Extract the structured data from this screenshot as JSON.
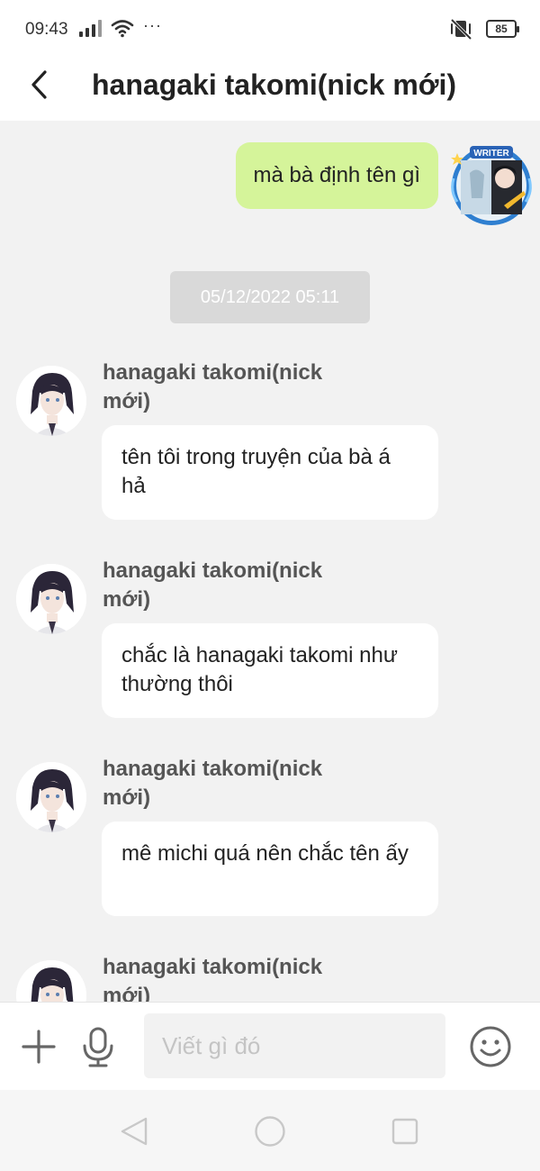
{
  "status_bar": {
    "time": "09:43",
    "battery": "85",
    "icons": [
      "signal-icon",
      "wifi-icon",
      "more-dots-icon",
      "vibrate-mute-icon",
      "battery-icon"
    ]
  },
  "header": {
    "title": "hanagaki takomi(nick mới)",
    "back_icon": "chevron-left-icon"
  },
  "messages": {
    "outgoing": {
      "text": "mà bà định tên gì",
      "avatar_badge": "WRITER"
    },
    "date_separator": "05/12/2022 05:11",
    "incoming": [
      {
        "sender": "hanagaki takomi(nick mới)",
        "text": "tên tôi trong truyện của bà á hả"
      },
      {
        "sender": "hanagaki takomi(nick mới)",
        "text": "chắc là hanagaki takomi như thường thôi"
      },
      {
        "sender": "hanagaki takomi(nick mới)",
        "text": "mê michi quá nên chắc tên ấy"
      },
      {
        "sender": "hanagaki takomi(nick mới)",
        "text": ""
      }
    ]
  },
  "composer": {
    "placeholder": "Viết gì đó",
    "icons": [
      "plus-icon",
      "microphone-icon",
      "emoji-icon"
    ]
  },
  "nav_bar": {
    "icons": [
      "nav-back-icon",
      "nav-home-icon",
      "nav-recent-icon"
    ]
  },
  "colors": {
    "outgoing_bubble": "#d5f49a",
    "incoming_bubble": "#ffffff",
    "chat_background": "#f2f2f2",
    "date_chip": "#d9d9d9"
  }
}
